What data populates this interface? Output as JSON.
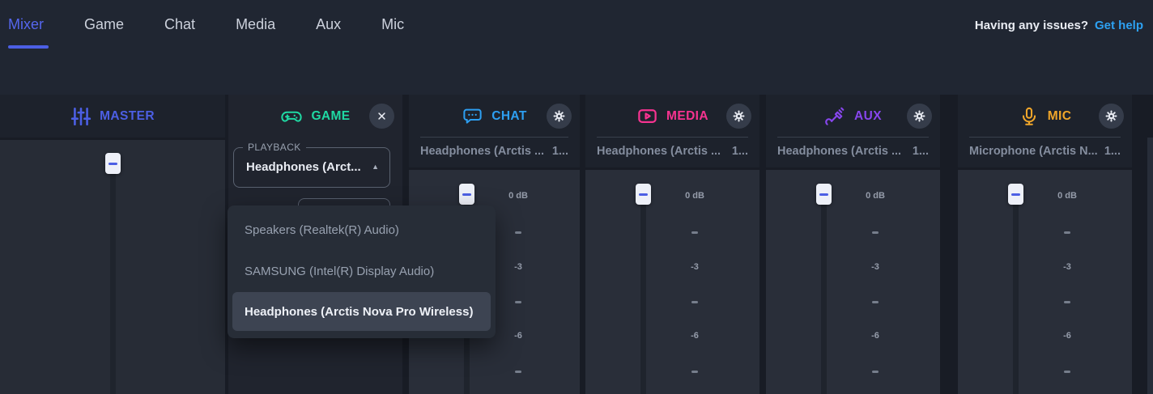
{
  "nav": {
    "tabs": [
      {
        "label": "Mixer",
        "active": true
      },
      {
        "label": "Game",
        "active": false
      },
      {
        "label": "Chat",
        "active": false
      },
      {
        "label": "Media",
        "active": false
      },
      {
        "label": "Aux",
        "active": false
      },
      {
        "label": "Mic",
        "active": false
      }
    ],
    "issues_prompt": "Having any issues?",
    "get_help_label": "Get help"
  },
  "mixer": {
    "scale": {
      "t0": "0 dB",
      "t3": "-3",
      "t6": "-6"
    },
    "channels": {
      "master": {
        "label": "MASTER",
        "accent": "#4c5fe4"
      },
      "game": {
        "label": "GAME",
        "accent": "#1fd9a3",
        "playback": {
          "legend": "PLAYBACK",
          "value": "Headphones (Arct...",
          "caret": "▲",
          "options": [
            "Speakers (Realtek(R) Audio)",
            "SAMSUNG (Intel(R) Display Audio)",
            "Headphones (Arctis Nova Pro Wireless)"
          ],
          "selected": "Headphones (Arctis Nova Pro Wireless)"
        }
      },
      "chat": {
        "label": "CHAT",
        "accent": "#2d9ff2",
        "device": "Headphones (Arctis ...",
        "device_extra": "1..."
      },
      "media": {
        "label": "MEDIA",
        "accent": "#f63390",
        "device": "Headphones (Arctis ...",
        "device_extra": "1..."
      },
      "aux": {
        "label": "AUX",
        "accent": "#8846ee",
        "device": "Headphones (Arctis ...",
        "device_extra": "1..."
      },
      "mic": {
        "label": "MIC",
        "accent": "#f0a62a",
        "device": "Microphone (Arctis N...",
        "device_extra": "1..."
      }
    }
  }
}
